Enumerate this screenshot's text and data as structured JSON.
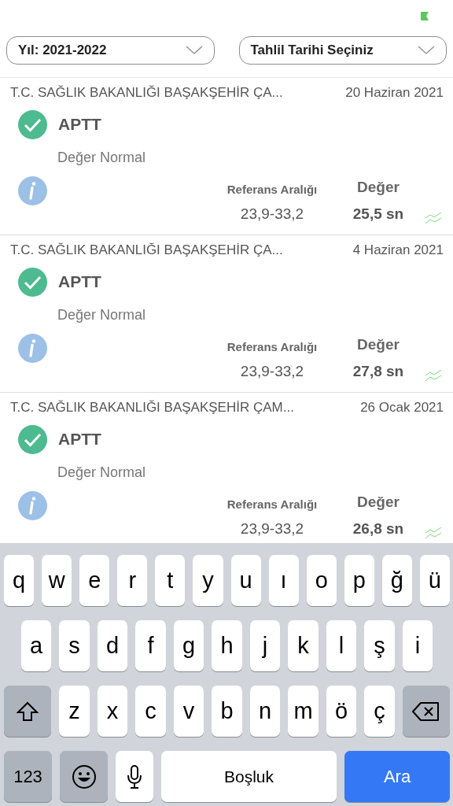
{
  "filters": [
    {
      "label": "Yıl: 2021-2022"
    },
    {
      "label": "Tahlil Tarihi Seçiniz"
    }
  ],
  "results": [
    {
      "institution": "T.C. SAĞLIK BAKANLIĞI BAŞAKŞEHİR ÇA...",
      "date": "20 Haziran 2021",
      "test": "APTT",
      "status_text": "Değer Normal",
      "ref_label": "Referans Aralığı",
      "ref_value": "23,9-33,2",
      "value_label": "Değer",
      "value": "25,5 sn"
    },
    {
      "institution": "T.C. SAĞLIK BAKANLIĞI BAŞAKŞEHİR ÇA...",
      "date": "4 Haziran 2021",
      "test": "APTT",
      "status_text": "Değer Normal",
      "ref_label": "Referans Aralığı",
      "ref_value": "23,9-33,2",
      "value_label": "Değer",
      "value": "27,8 sn"
    },
    {
      "institution": "T.C. SAĞLIK BAKANLIĞI BAŞAKŞEHİR ÇAM...",
      "date": "26 Ocak 2021",
      "test": "APTT",
      "status_text": "Değer Normal",
      "ref_label": "Referans Aralığı",
      "ref_value": "23,9-33,2",
      "value_label": "Değer",
      "value": "26,8 sn"
    }
  ],
  "keyboard": {
    "rows": [
      [
        {
          "kind": "letter",
          "label": "q"
        },
        {
          "kind": "letter",
          "label": "w"
        },
        {
          "kind": "letter",
          "label": "e"
        },
        {
          "kind": "letter",
          "label": "r"
        },
        {
          "kind": "letter",
          "label": "t"
        },
        {
          "kind": "letter",
          "label": "y"
        },
        {
          "kind": "letter",
          "label": "u"
        },
        {
          "kind": "letter",
          "label": "ı"
        },
        {
          "kind": "letter",
          "label": "o"
        },
        {
          "kind": "letter",
          "label": "p"
        },
        {
          "kind": "letter",
          "label": "ğ"
        },
        {
          "kind": "letter",
          "label": "ü"
        }
      ],
      [
        {
          "kind": "letter",
          "label": "a"
        },
        {
          "kind": "letter",
          "label": "s"
        },
        {
          "kind": "letter",
          "label": "d"
        },
        {
          "kind": "letter",
          "label": "f"
        },
        {
          "kind": "letter",
          "label": "g"
        },
        {
          "kind": "letter",
          "label": "h"
        },
        {
          "kind": "letter",
          "label": "j"
        },
        {
          "kind": "letter",
          "label": "k"
        },
        {
          "kind": "letter",
          "label": "l"
        },
        {
          "kind": "letter",
          "label": "ş"
        },
        {
          "kind": "letter",
          "label": "i"
        }
      ],
      [
        {
          "kind": "shift"
        },
        {
          "kind": "letter",
          "label": "z"
        },
        {
          "kind": "letter",
          "label": "x"
        },
        {
          "kind": "letter",
          "label": "c"
        },
        {
          "kind": "letter",
          "label": "v"
        },
        {
          "kind": "letter",
          "label": "b"
        },
        {
          "kind": "letter",
          "label": "n"
        },
        {
          "kind": "letter",
          "label": "m"
        },
        {
          "kind": "letter",
          "label": "ö"
        },
        {
          "kind": "letter",
          "label": "ç"
        },
        {
          "kind": "delete"
        }
      ]
    ],
    "bottom_bar": [
      {
        "kind": "numbers",
        "label": "123"
      },
      {
        "kind": "emoji"
      },
      {
        "kind": "mic"
      },
      {
        "kind": "space",
        "label": "Boşluk"
      },
      {
        "kind": "search",
        "label": "Ara"
      }
    ]
  }
}
